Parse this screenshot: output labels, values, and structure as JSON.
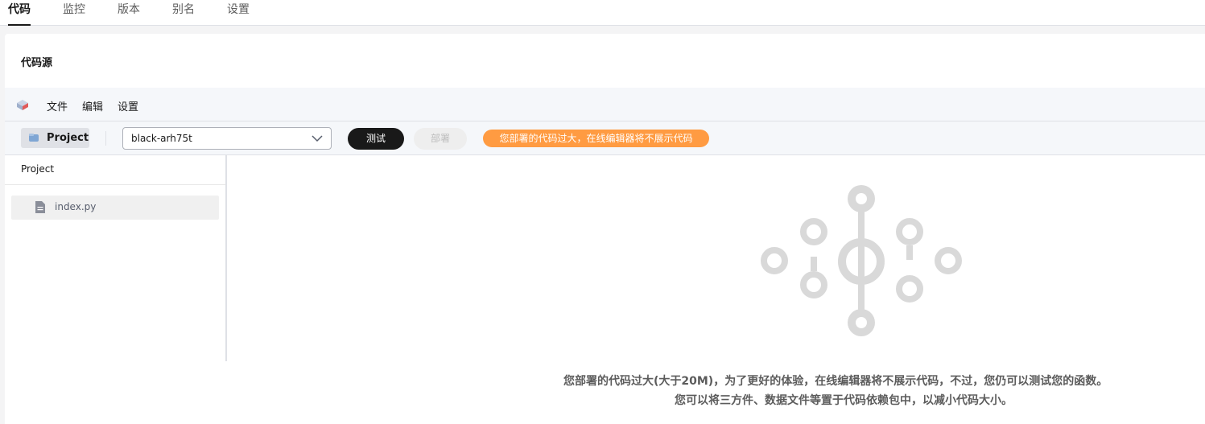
{
  "tabs": [
    {
      "label": "代码",
      "active": true
    },
    {
      "label": "监控",
      "active": false
    },
    {
      "label": "版本",
      "active": false
    },
    {
      "label": "别名",
      "active": false
    },
    {
      "label": "设置",
      "active": false
    }
  ],
  "section": {
    "title": "代码源"
  },
  "editor": {
    "menu": [
      "文件",
      "编辑",
      "设置"
    ],
    "toolbar": {
      "project_label": "Project",
      "version_select": "black-arh75t",
      "test_label": "测试",
      "deploy_label": "部署",
      "warning": "您部署的代码过大，在线编辑器将不展示代码"
    },
    "sidebar": {
      "title": "Project",
      "files": [
        "index.py"
      ]
    },
    "empty": {
      "line1": "您部署的代码过大(大于20M)，为了更好的体验，在线编辑器将不展示代码，不过，您仍可以测试您的函数。",
      "line2": "您可以将三方件、数据文件等置于代码依赖包中，以减小代码大小。"
    }
  },
  "colors": {
    "primary_button": "#191919",
    "warning_badge": "#ff9b42",
    "graphic_gray": "#d9d9d9"
  }
}
